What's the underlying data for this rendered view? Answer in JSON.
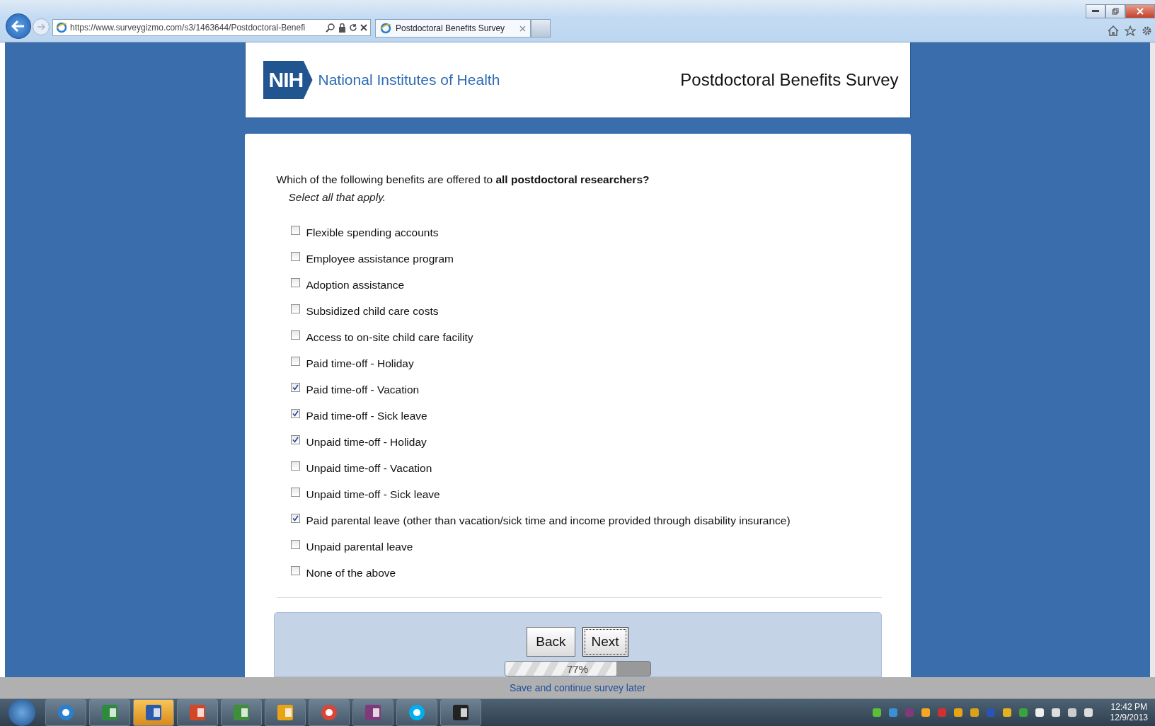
{
  "browser": {
    "address": "https://www.surveygizmo.com/s3/1463644/Postdoctoral-Benefi",
    "tab": {
      "title": "Postdoctoral Benefits Survey"
    }
  },
  "header": {
    "logo_mark": "NIH",
    "logo_text": "National Institutes of Health",
    "title": "Postdoctoral Benefits Survey"
  },
  "question": {
    "text": "Which of the following benefits are offered to **all postdoctoral researchers?**",
    "instruction": "Select all that apply.",
    "options": [
      {
        "label": "Flexible spending accounts",
        "checked": false
      },
      {
        "label": "Employee assistance program",
        "checked": false
      },
      {
        "label": "Adoption assistance",
        "checked": false
      },
      {
        "label": "Subsidized child care costs",
        "checked": false
      },
      {
        "label": "Access to on-site child care facility",
        "checked": false
      },
      {
        "label": "Paid time-off - Holiday",
        "checked": false
      },
      {
        "label": "Paid time-off - Vacation",
        "checked": true
      },
      {
        "label": "Paid time-off - Sick leave",
        "checked": true
      },
      {
        "label": "Unpaid time-off - Holiday",
        "checked": true
      },
      {
        "label": "Unpaid time-off - Vacation",
        "checked": false
      },
      {
        "label": "Unpaid time-off - Sick leave",
        "checked": false
      },
      {
        "label": "Paid parental leave (other than vacation/sick time and income provided through disability insurance)",
        "checked": true
      },
      {
        "label": "Unpaid parental leave",
        "checked": false
      },
      {
        "label": "None of the above",
        "checked": false
      }
    ]
  },
  "buttons": [
    {
      "label": "Back",
      "focused": false
    },
    {
      "label": "Next",
      "focused": true
    }
  ],
  "progress": {
    "level": 0.77,
    "reading": "77%"
  },
  "save_link": "Save and continue survey later",
  "taskbar": {
    "time": "12:42 PM",
    "date": "12/9/2013"
  }
}
